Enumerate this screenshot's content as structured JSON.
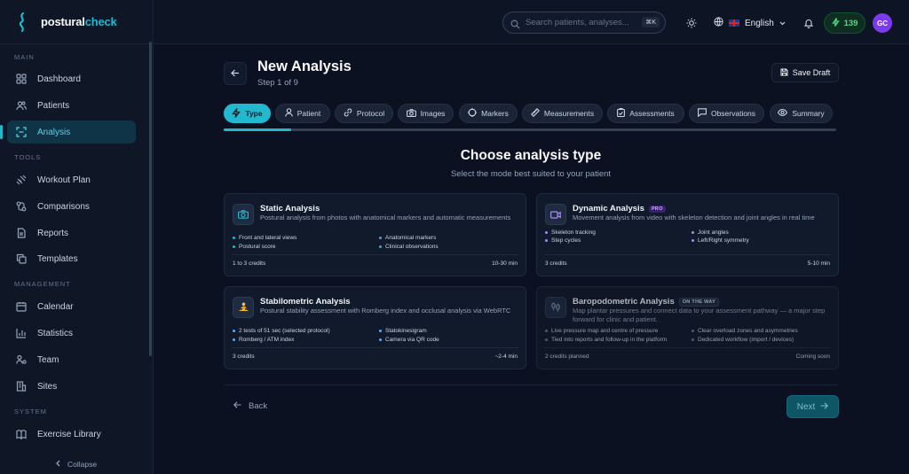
{
  "brand": {
    "part1": "postural",
    "part2": "check"
  },
  "sidebar": {
    "sections": {
      "main": "MAIN",
      "tools": "TOOLS",
      "management": "MANAGEMENT",
      "system": "SYSTEM"
    },
    "items": [
      {
        "label": "Dashboard",
        "icon": "grid-icon"
      },
      {
        "label": "Patients",
        "icon": "users-icon"
      },
      {
        "label": "Analysis",
        "icon": "scan-icon",
        "active": true
      },
      {
        "label": "Workout Plan",
        "icon": "dumbbell-icon"
      },
      {
        "label": "Comparisons",
        "icon": "compare-icon"
      },
      {
        "label": "Reports",
        "icon": "file-icon"
      },
      {
        "label": "Templates",
        "icon": "copy-icon"
      },
      {
        "label": "Calendar",
        "icon": "calendar-icon"
      },
      {
        "label": "Statistics",
        "icon": "bar-chart-icon"
      },
      {
        "label": "Team",
        "icon": "team-icon"
      },
      {
        "label": "Sites",
        "icon": "building-icon"
      },
      {
        "label": "Exercise Library",
        "icon": "book-icon"
      }
    ],
    "collapse_label": "Collapse"
  },
  "header": {
    "search_placeholder": "Search patients, analyses...",
    "search_shortcut": "⌘K",
    "language": "English",
    "credits": "139",
    "avatar_initials": "GC"
  },
  "main": {
    "title": "New Analysis",
    "step": "Step 1 of 9",
    "save_draft": "Save Draft",
    "progress": 0.11,
    "steps": [
      "Type",
      "Patient",
      "Protocol",
      "Images",
      "Markers",
      "Measurements",
      "Assessments",
      "Observations",
      "Summary"
    ],
    "section_title": "Choose analysis type",
    "section_subtitle": "Select the mode best suited to your patient",
    "back_label": "Back",
    "next_label": "Next"
  },
  "cards": [
    {
      "title": "Static Analysis",
      "badge": "",
      "description": "Postural analysis from photos with anatomical markers and automatic measurements",
      "features_left": [
        "Front and lateral views",
        "Postural score"
      ],
      "features_right": [
        "Anatomical markers",
        "Clinical observations"
      ],
      "footer_left": "1 to 3 credits",
      "footer_right": "10-30 min",
      "dot_color": "#22b8cf"
    },
    {
      "title": "Dynamic Analysis",
      "badge": "PRO",
      "description": "Movement analysis from video with skeleton detection and joint angles in real time",
      "features_left": [
        "Skeleton tracking",
        "Step cycles"
      ],
      "features_right": [
        "Joint angles",
        "Left/Right symmetry"
      ],
      "footer_left": "3 credits",
      "footer_right": "5-10 min",
      "dot_color": "#a78bfa"
    },
    {
      "title": "Stabilometric Analysis",
      "badge": "",
      "description": "Postural stability assessment with Romberg index and occlusal analysis via WebRTC",
      "features_left": [
        "2 tests of 51 sec (selected protocol)",
        "Romberg / ATM index"
      ],
      "features_right": [
        "Statokinesigram",
        "Camera via QR code"
      ],
      "footer_left": "3 credits",
      "footer_right": "~2-4 min",
      "dot_color": "#60a5fa"
    },
    {
      "title": "Baropodometric Analysis",
      "badge": "ON THE WAY",
      "description": "Map plantar pressures and connect data to your assessment pathway — a major step forward for clinic and patient.",
      "features_left": [
        "Live pressure map and centre of pressure",
        "Tied into reports and follow-up in the platform"
      ],
      "features_right": [
        "Clear overload zones and asymmetries",
        "Dedicated workflow (import / devices)"
      ],
      "footer_left": "2 credits planned",
      "footer_right": "Coming soon",
      "dot_color": "#64748b"
    }
  ]
}
